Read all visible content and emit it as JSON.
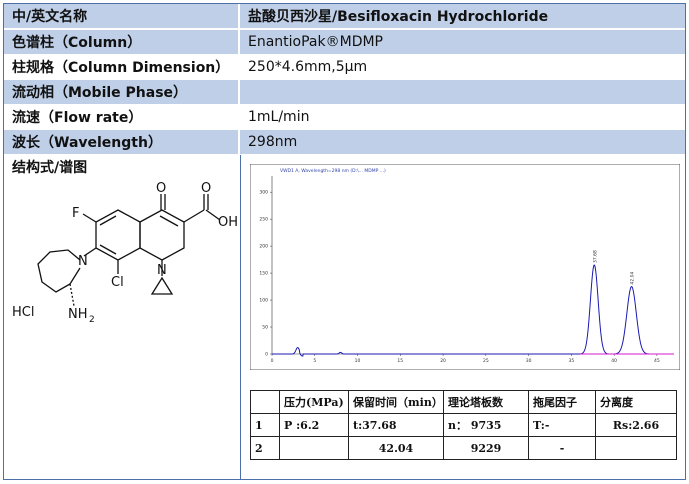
{
  "rows": [
    {
      "label": "中/英文名称",
      "value": "盐酸贝西沙星/Besifloxacin Hydrochloride"
    },
    {
      "label": "色谱柱（Column）",
      "value": "EnantioPak®MDMP"
    },
    {
      "label": "柱规格（Column Dimension）",
      "value": "250*4.6mm,5μm"
    },
    {
      "label": "流动相（Mobile Phase）",
      "value": ""
    },
    {
      "label": "流速（Flow rate）",
      "value": "1mL/min"
    },
    {
      "label": "波长（Wavelength）",
      "value": "298nm"
    },
    {
      "label": "结构式/谱图",
      "value": ""
    }
  ],
  "structure": {
    "labels": {
      "f": "F",
      "o": "O",
      "oh": "OH",
      "n1": "N",
      "n2": "N",
      "cl": "Cl",
      "hcl": "HCl",
      "nh2": "NH",
      "nh2_sub": "2"
    }
  },
  "chart_data": {
    "type": "line",
    "header_text": "VWD1 A, Wavelength=298 nm (D:\\... MDMP ...)",
    "peak_labels": [
      "37.68",
      "42.04"
    ],
    "xlim": [
      0,
      47
    ],
    "ylim": [
      0,
      330
    ],
    "x_ticks": [
      "0",
      "5",
      "10",
      "15",
      "20",
      "25",
      "30",
      "35",
      "40",
      "45"
    ],
    "y_ticks": [
      "0",
      "50",
      "100",
      "150",
      "200",
      "250",
      "300"
    ],
    "series": [
      {
        "color": "#1a1ab0",
        "points": [
          [
            0,
            0
          ],
          [
            2,
            0
          ],
          [
            3,
            12
          ],
          [
            3.4,
            -2
          ],
          [
            4,
            0
          ],
          [
            8,
            3
          ],
          [
            25,
            0
          ],
          [
            36,
            2
          ],
          [
            37.68,
            165
          ],
          [
            39,
            5
          ],
          [
            40.5,
            5
          ],
          [
            42.04,
            125
          ],
          [
            43.5,
            0
          ],
          [
            47,
            0
          ]
        ]
      },
      {
        "color": "#d01ad0",
        "points": [
          [
            36,
            0
          ],
          [
            47,
            0
          ]
        ]
      }
    ]
  },
  "results": {
    "headers": [
      "",
      "压力(MPa)",
      "保留时间（min）",
      "理论塔板数",
      "拖尾因子",
      "分离度"
    ],
    "rows": [
      [
        "1",
        "P :6.2",
        "t:37.68",
        "n：  9735",
        "T:-",
        "Rs:2.66"
      ],
      [
        "2",
        "",
        "42.04",
        "9229",
        "-",
        ""
      ]
    ]
  }
}
